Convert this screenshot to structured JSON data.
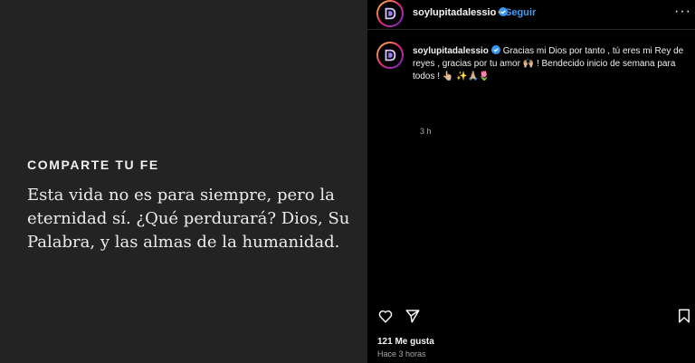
{
  "post_image": {
    "kicker": "COMPARTE TU FE",
    "verse": "Esta vida no es para siempre, pero la eternidad sí. ¿Qué perdurará? Dios, Su Palabra, y las almas de la humanidad."
  },
  "header": {
    "username": "soylupitadalessio",
    "separator": "•",
    "follow_label": "Seguir",
    "more_label": "···"
  },
  "caption": {
    "username": "soylupitadalessio",
    "text": "Gracias mi Dios por tanto , tú eres mi Rey de reyes , gracias por tu amor 🙌🏼 ! Bendecido inicio de semana para todos ! 👆🏼 ✨🙏🏼🌷",
    "time": "3 h"
  },
  "engagement": {
    "likes": "121 Me gusta",
    "posted": "Hace 3 horas"
  },
  "colors": {
    "accent": "#4a9bf0",
    "verified": "#3897f0"
  },
  "icons": {
    "like": "heart-icon",
    "share": "paper-plane-icon",
    "save": "bookmark-icon",
    "more": "more-horizontal-icon",
    "verified": "verified-badge-icon"
  }
}
